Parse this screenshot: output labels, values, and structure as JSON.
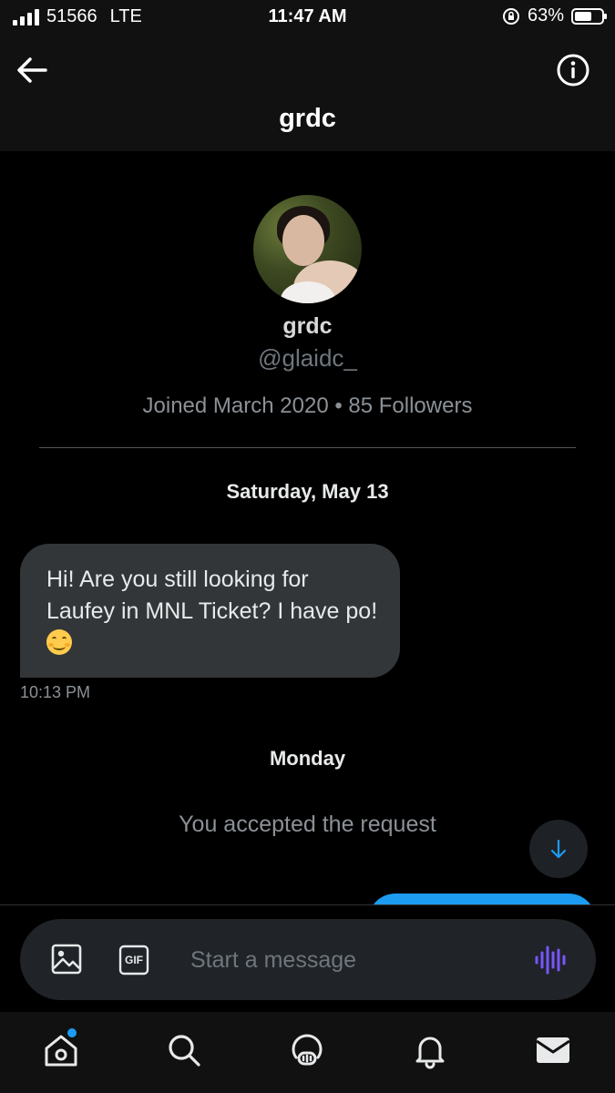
{
  "status_bar": {
    "carrier": "51566",
    "network": "LTE",
    "time": "11:47 AM",
    "battery_percent": "63%",
    "battery_level": 0.63
  },
  "header": {
    "title": "grdc",
    "back_icon": "arrow-left-icon",
    "info_icon": "info-icon"
  },
  "profile": {
    "name": "grdc",
    "handle": "@glaidc_",
    "meta": "Joined March 2020 • 85 Followers"
  },
  "conversation": {
    "date_1": "Saturday, May 13",
    "messages": [
      {
        "text": "Hi! Are you still looking for Laufey in MNL Ticket? I have po!",
        "emoji": "smiling-face",
        "time": "10:13 PM"
      }
    ],
    "date_2": "Monday",
    "system_message": "You accepted the request"
  },
  "composer": {
    "placeholder": "Start a message",
    "gif_label": "GIF"
  },
  "tab_bar": {
    "tabs": [
      "home-icon",
      "search-icon",
      "spaces-icon",
      "notifications-icon",
      "messages-icon"
    ]
  },
  "colors": {
    "accent": "#1d9bf0",
    "bubble": "#333639",
    "voice_accent": "#7856ff"
  }
}
